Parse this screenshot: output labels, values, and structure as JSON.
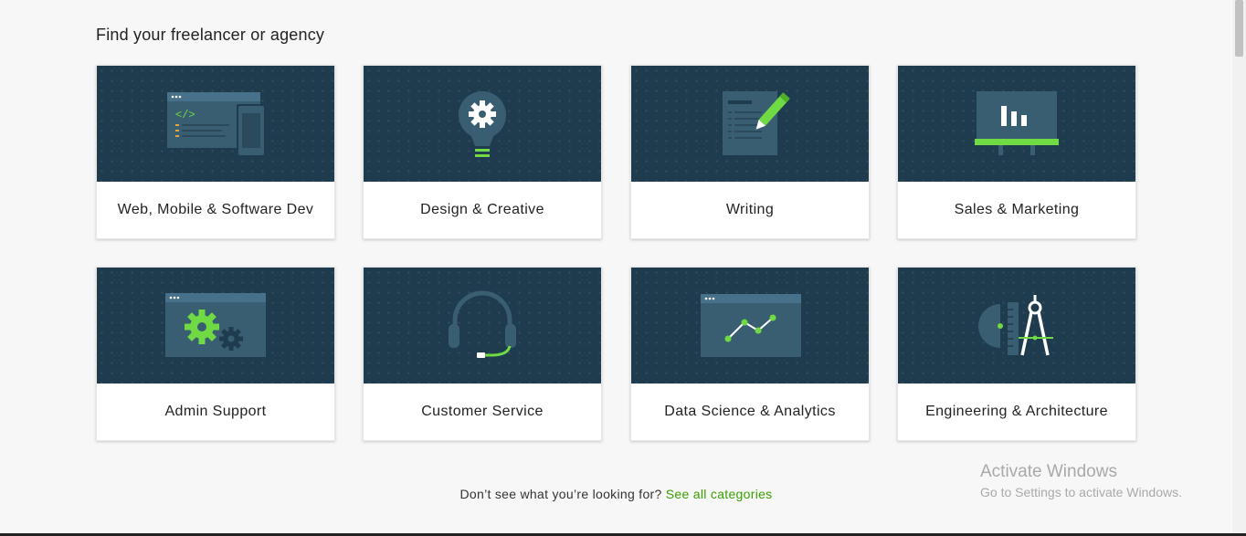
{
  "section": {
    "heading": "Find your freelancer or agency"
  },
  "categories": [
    {
      "label": "Web, Mobile & Software Dev",
      "icon": "code-devices-icon"
    },
    {
      "label": "Design & Creative",
      "icon": "lightbulb-gear-icon"
    },
    {
      "label": "Writing",
      "icon": "document-pen-icon"
    },
    {
      "label": "Sales & Marketing",
      "icon": "presentation-board-icon"
    },
    {
      "label": "Admin Support",
      "icon": "window-gears-icon"
    },
    {
      "label": "Customer Service",
      "icon": "headset-icon"
    },
    {
      "label": "Data Science & Analytics",
      "icon": "line-chart-window-icon"
    },
    {
      "label": "Engineering & Architecture",
      "icon": "compass-ruler-icon"
    }
  ],
  "footer": {
    "prompt": "Don’t see what you’re looking for?",
    "link": "See all categories"
  },
  "watermark": {
    "title": "Activate Windows",
    "subtitle": "Go to Settings to activate Windows."
  },
  "colors": {
    "card_art_bg": "#1f3c4e",
    "accent": "#6fda44",
    "link": "#37a000",
    "icon_mid": "#3a5e71"
  }
}
